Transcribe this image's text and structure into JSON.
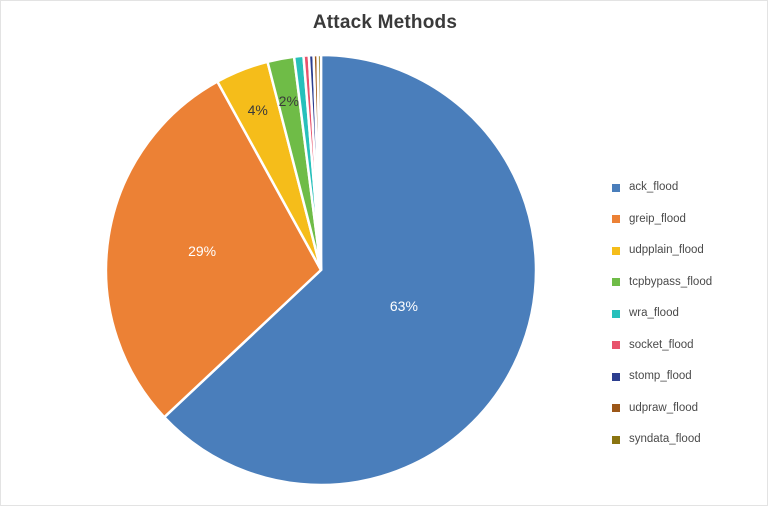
{
  "chart": {
    "title": "Attack Methods"
  },
  "chart_data": {
    "type": "pie",
    "title": "Attack Methods",
    "xlabel": "",
    "ylabel": "",
    "legend_position": "right",
    "grid": false,
    "categories": [
      "ack_flood",
      "greip_flood",
      "udpplain_flood",
      "tcpbypass_flood",
      "wra_flood",
      "socket_flood",
      "stomp_flood",
      "udpraw_flood",
      "syndata_flood"
    ],
    "values": [
      63,
      29,
      4,
      2,
      0.7,
      0.4,
      0.35,
      0.3,
      0.25
    ],
    "value_labels": [
      "63%",
      "29%",
      "4%",
      "2%",
      "",
      "",
      "",
      "",
      ""
    ],
    "colors": [
      "#4a7ebb",
      "#ec8135",
      "#f5bd1a",
      "#6fbc47",
      "#27c0bb",
      "#e8536c",
      "#2c3e8f",
      "#9c5718",
      "#8a7410"
    ]
  },
  "legend": {
    "items": [
      {
        "label": "ack_flood",
        "color": "#4a7ebb"
      },
      {
        "label": "greip_flood",
        "color": "#ec8135"
      },
      {
        "label": "udpplain_flood",
        "color": "#f5bd1a"
      },
      {
        "label": "tcpbypass_flood",
        "color": "#6fbc47"
      },
      {
        "label": "wra_flood",
        "color": "#27c0bb"
      },
      {
        "label": "socket_flood",
        "color": "#e8536c"
      },
      {
        "label": "stomp_flood",
        "color": "#2c3e8f"
      },
      {
        "label": "udpraw_flood",
        "color": "#9c5718"
      },
      {
        "label": "syndata_flood",
        "color": "#8a7410"
      }
    ]
  }
}
